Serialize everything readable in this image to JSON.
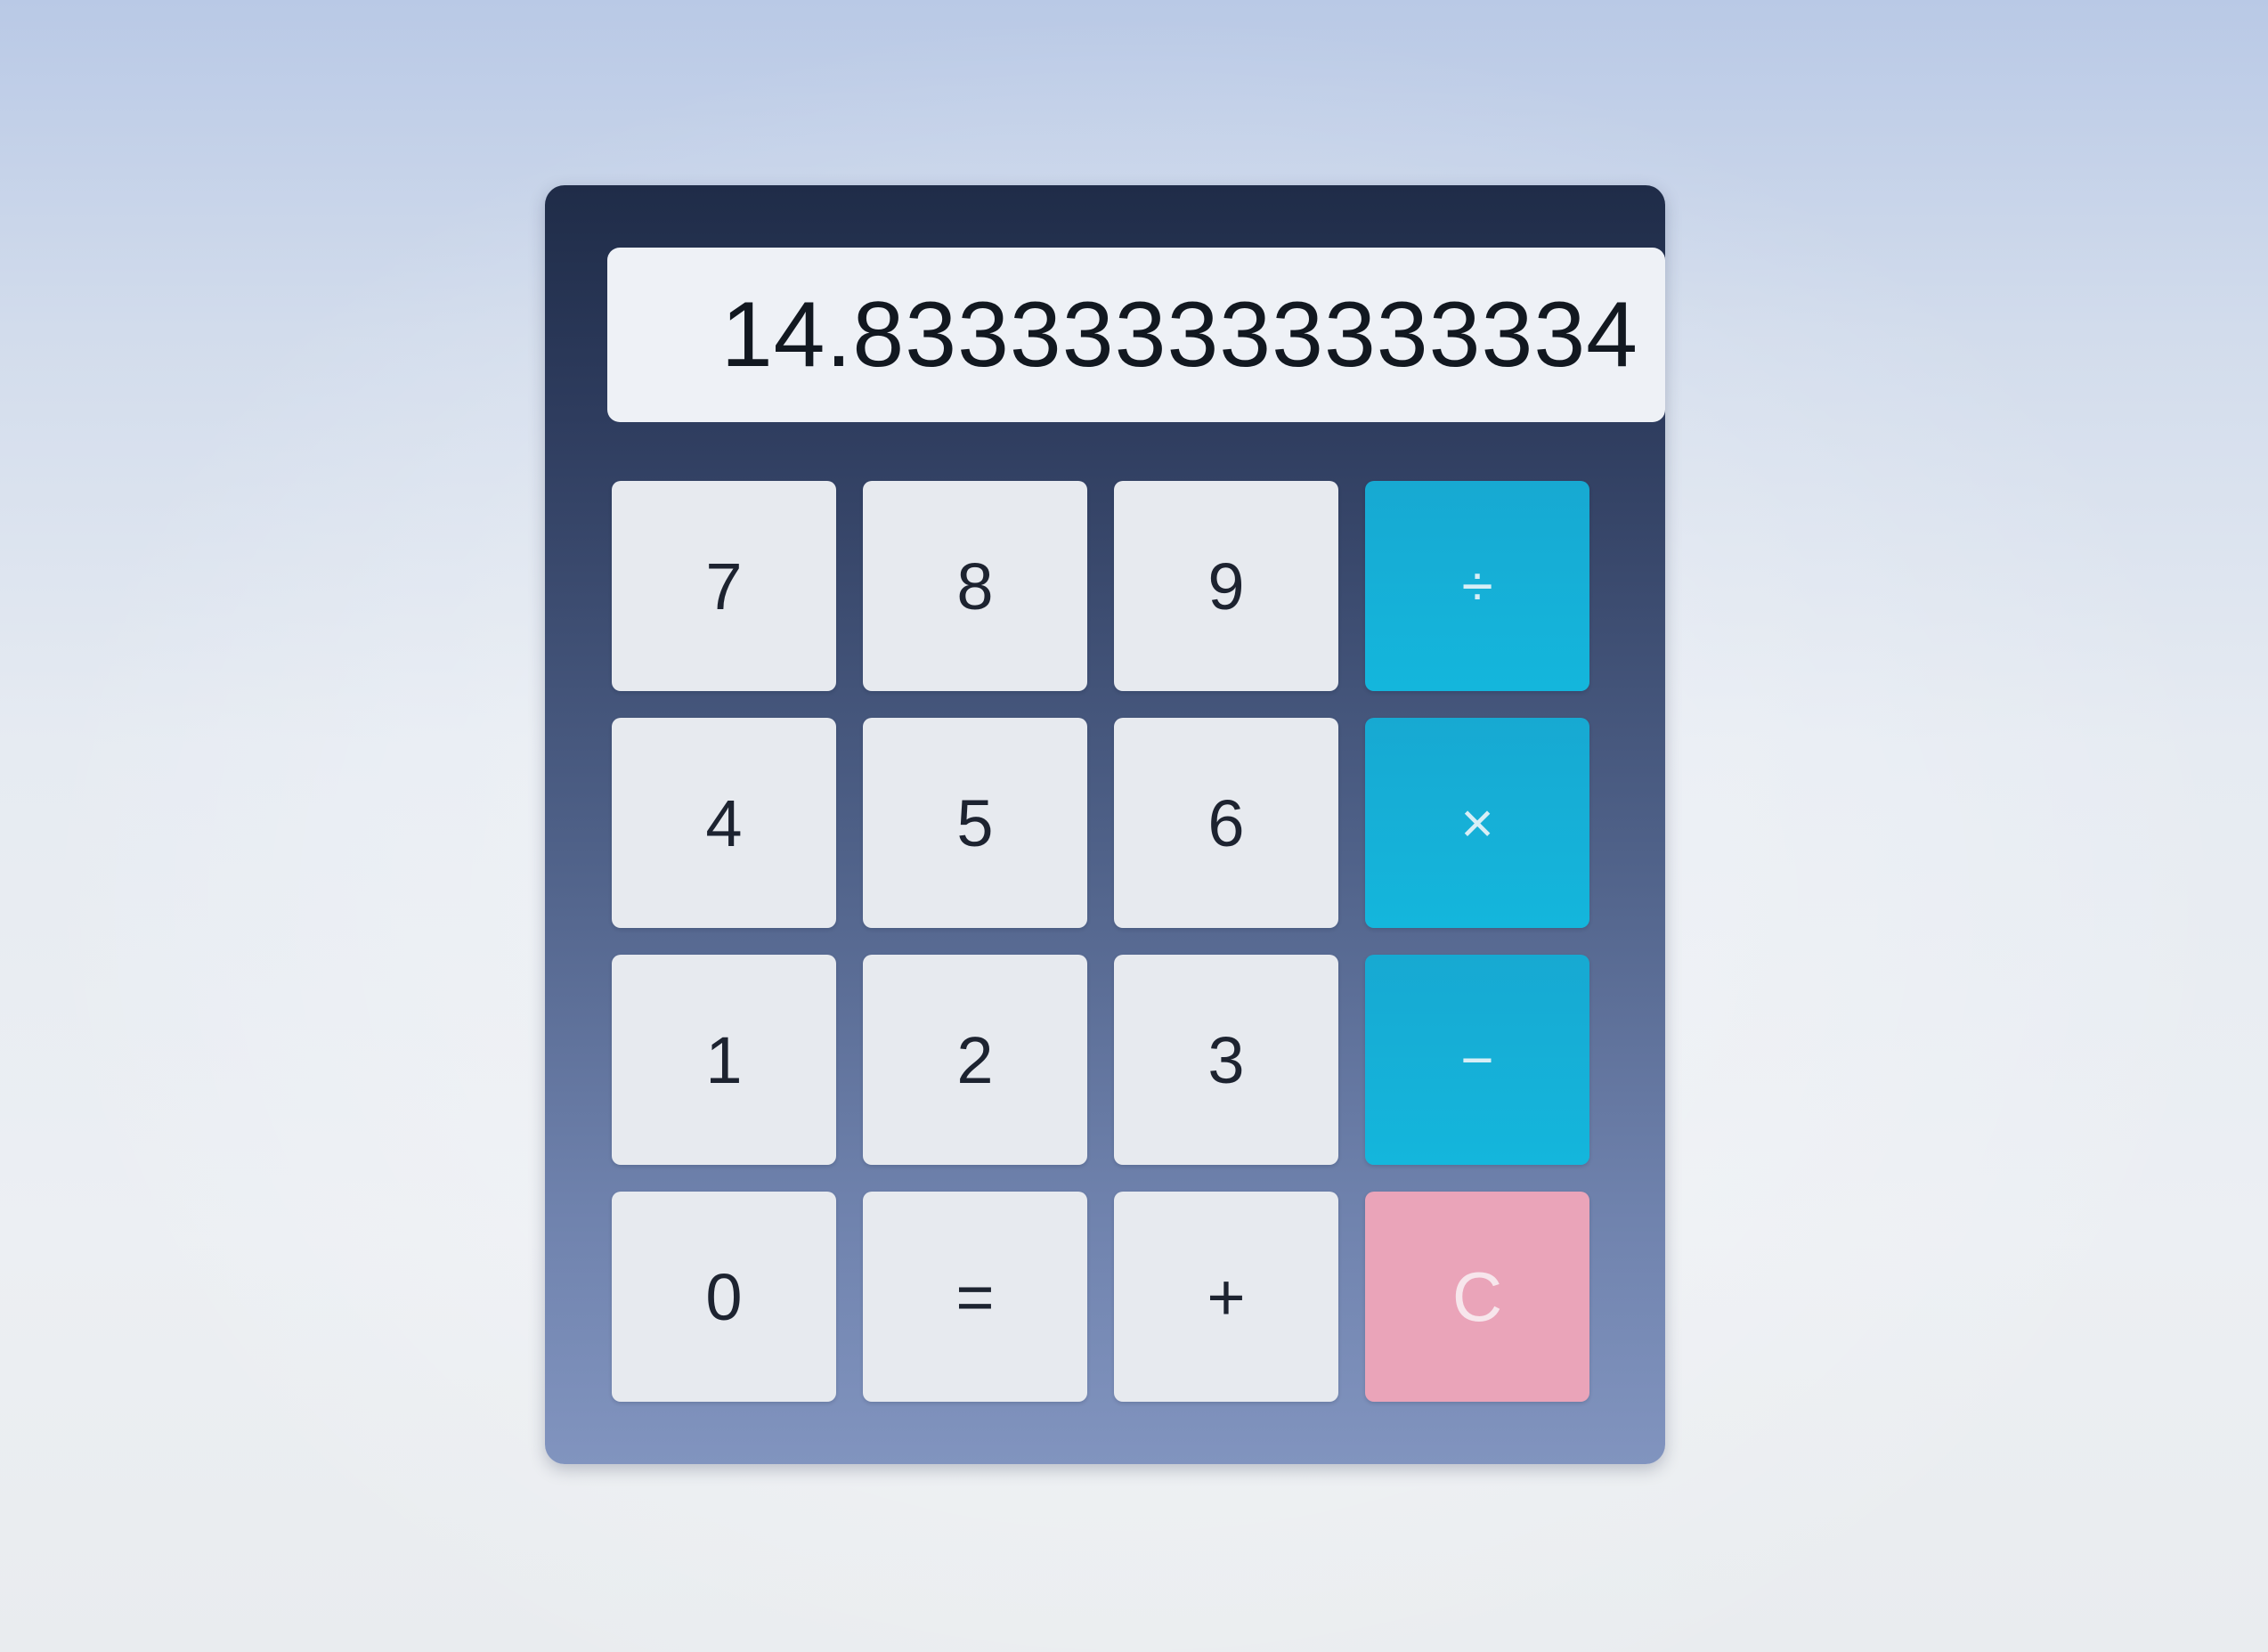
{
  "calculator": {
    "display_value": "14.833333333333334",
    "keys": [
      {
        "label": "7",
        "type": "digit"
      },
      {
        "label": "8",
        "type": "digit"
      },
      {
        "label": "9",
        "type": "digit"
      },
      {
        "label": "÷",
        "type": "operator"
      },
      {
        "label": "4",
        "type": "digit"
      },
      {
        "label": "5",
        "type": "digit"
      },
      {
        "label": "6",
        "type": "digit"
      },
      {
        "label": "×",
        "type": "operator"
      },
      {
        "label": "1",
        "type": "digit"
      },
      {
        "label": "2",
        "type": "digit"
      },
      {
        "label": "3",
        "type": "digit"
      },
      {
        "label": "−",
        "type": "operator"
      },
      {
        "label": "0",
        "type": "digit"
      },
      {
        "label": "=",
        "type": "equals"
      },
      {
        "label": "+",
        "type": "operator"
      },
      {
        "label": "C",
        "type": "clear"
      }
    ]
  },
  "colors": {
    "operator_key": "#15b0d8",
    "clear_key": "#eaa4b9",
    "digit_key": "#e7eaef",
    "body_top": "#1f2c48",
    "body_bottom": "#8194bf"
  }
}
